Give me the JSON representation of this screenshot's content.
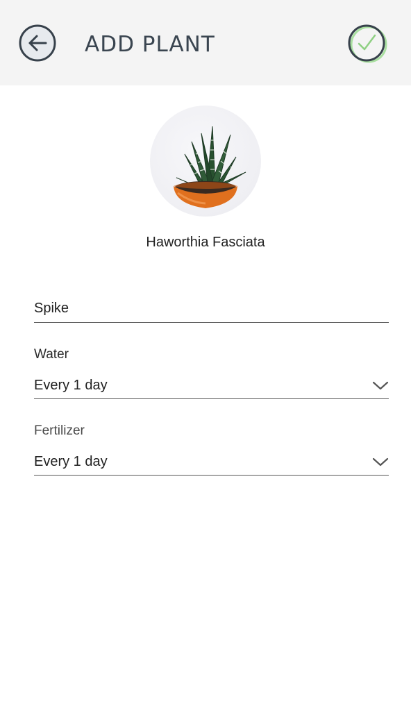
{
  "header": {
    "title": "ADD PLANT",
    "back_icon": "arrow-left-circle-icon",
    "confirm_icon": "check-circle-icon",
    "background": "#f4f4f4",
    "accent": "#7cc47a"
  },
  "plant": {
    "image": "haworthia-plant-photo",
    "name": "Haworthia Fasciata"
  },
  "form": {
    "nickname": {
      "value": "Spike"
    },
    "water": {
      "label": "Water",
      "value": "Every 1 day",
      "icon": "chevron-down-icon"
    },
    "fertilizer": {
      "label": "Fertilizer",
      "value": "Every 1 day",
      "icon": "chevron-down-icon"
    }
  }
}
